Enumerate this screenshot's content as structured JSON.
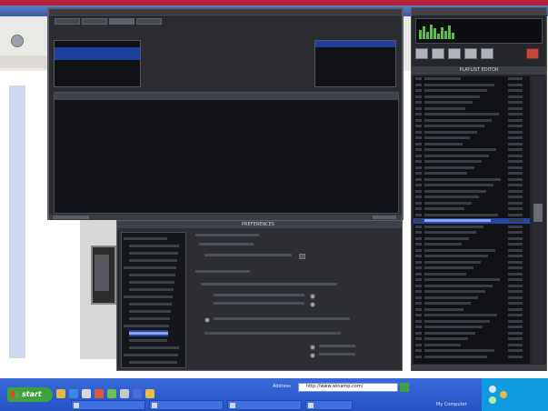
{
  "media_library": {
    "title": "",
    "tabs": [
      "",
      "",
      "",
      ""
    ],
    "genre_list": [
      "",
      "",
      "",
      ""
    ],
    "genre_selected_index": 1,
    "right_list": [
      "",
      ""
    ],
    "right_selected_index": 0,
    "columns": [
      "",
      "",
      "",
      "",
      ""
    ],
    "rows": [
      [
        "",
        "",
        "",
        "",
        ""
      ],
      [
        "",
        "",
        "",
        "",
        ""
      ],
      [
        "",
        "",
        "",
        "",
        ""
      ],
      [
        "",
        "",
        "",
        "",
        ""
      ],
      [
        "",
        "",
        "",
        "",
        ""
      ],
      [
        "",
        "",
        "",
        "",
        ""
      ],
      [
        "",
        "",
        "",
        "",
        ""
      ],
      [
        "",
        "",
        "",
        "",
        ""
      ]
    ]
  },
  "player": {
    "title": "",
    "time": "",
    "controls": [
      "",
      "",
      "",
      "",
      "",
      ""
    ]
  },
  "playlist": {
    "title": "PLAYLIST EDITOR",
    "selected_index": 24,
    "items_count": 48
  },
  "preferences": {
    "title": "PREFERENCES",
    "selected_tree_index": 13
  },
  "taskbar": {
    "start_label": "start",
    "address_label": "Address",
    "address_value": "http://www.winamp.com/",
    "my_computer": "My Computer",
    "tasks": [
      {
        "label": ""
      },
      {
        "label": ""
      },
      {
        "label": ""
      },
      {
        "label": ""
      }
    ],
    "clock_time": "",
    "clock_day": "",
    "clock_date": ""
  },
  "colors": {
    "selection": "#2745a4",
    "accent_green": "#57c23e",
    "taskbar_blue": "#2553c4",
    "start_green": "#3fa23a"
  }
}
